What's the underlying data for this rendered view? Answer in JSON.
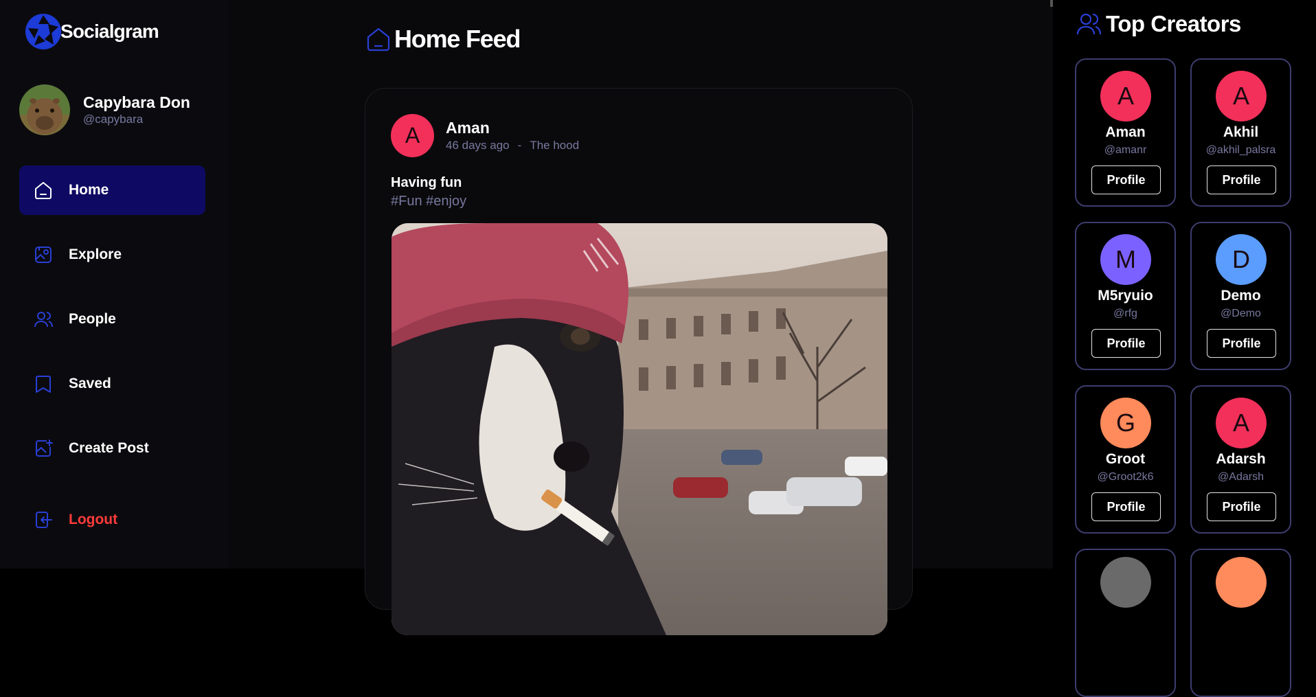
{
  "brand": {
    "name": "Socialgram",
    "accent": "#1d3bd6"
  },
  "user": {
    "name": "Capybara Don",
    "handle": "@capybara"
  },
  "nav": {
    "items": [
      {
        "label": "Home",
        "icon": "home-icon",
        "active": true
      },
      {
        "label": "Explore",
        "icon": "explore-icon"
      },
      {
        "label": "People",
        "icon": "people-icon"
      },
      {
        "label": "Saved",
        "icon": "bookmark-icon"
      },
      {
        "label": "Create Post",
        "icon": "create-post-icon"
      }
    ],
    "logout": "Logout"
  },
  "feed": {
    "title": "Home Feed",
    "post": {
      "avatar_letter": "A",
      "author": "Aman",
      "time": "46 days ago",
      "separator": "-",
      "location": "The hood",
      "caption": "Having fun",
      "tags": "#Fun #enjoy"
    }
  },
  "creators": {
    "title": "Top Creators",
    "list": [
      {
        "letter": "A",
        "name": "Aman",
        "handle": "@amanr",
        "color": "#f2305a",
        "button": "Profile"
      },
      {
        "letter": "A",
        "name": "Akhil",
        "handle": "@akhil_palsra",
        "color": "#f2305a",
        "button": "Profile"
      },
      {
        "letter": "M",
        "name": "M5ryuio",
        "handle": "@rfg",
        "color": "#7b61ff",
        "button": "Profile"
      },
      {
        "letter": "D",
        "name": "Demo",
        "handle": "@Demo",
        "color": "#5b9cff",
        "button": "Profile"
      },
      {
        "letter": "G",
        "name": "Groot",
        "handle": "@Groot2k6",
        "color": "#ff8a5b",
        "button": "Profile"
      },
      {
        "letter": "A",
        "name": "Adarsh",
        "handle": "@Adarsh",
        "color": "#f2305a",
        "button": "Profile"
      }
    ]
  }
}
